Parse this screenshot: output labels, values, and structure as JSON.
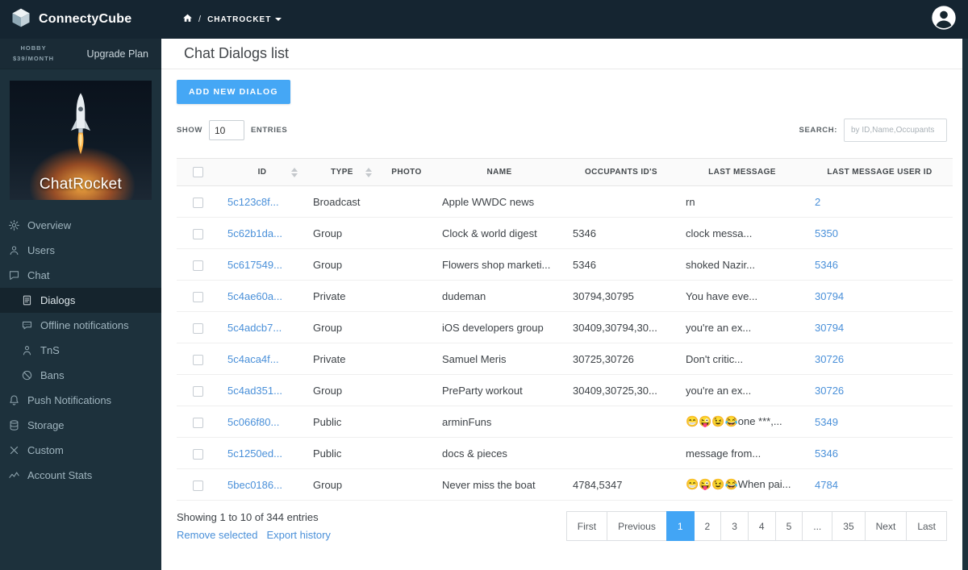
{
  "app": {
    "brand": "ConnectyCube"
  },
  "topbar": {
    "breadcrumb_app": "CHATROCKET"
  },
  "plan": {
    "tier": "HOBBY",
    "price": "$39/MONTH",
    "upgrade_label": "Upgrade Plan"
  },
  "project": {
    "name": "ChatRocket"
  },
  "sidebar": {
    "items": [
      {
        "label": "Overview"
      },
      {
        "label": "Users"
      },
      {
        "label": "Chat"
      },
      {
        "label": "Dialogs"
      },
      {
        "label": "Offline notifications"
      },
      {
        "label": "TnS"
      },
      {
        "label": "Bans"
      },
      {
        "label": "Push Notifications"
      },
      {
        "label": "Storage"
      },
      {
        "label": "Custom"
      },
      {
        "label": "Account Stats"
      }
    ]
  },
  "page": {
    "title": "Chat Dialogs list",
    "add_button": "ADD NEW DIALOG",
    "show_label": "SHOW",
    "show_value": "10",
    "entries_label": "ENTRIES",
    "search_label": "SEARCH:",
    "search_placeholder": "by ID,Name,Occupants"
  },
  "table": {
    "headers": {
      "id": "ID",
      "type": "TYPE",
      "photo": "PHOTO",
      "name": "NAME",
      "occupants": "OCCUPANTS ID'S",
      "last_message": "LAST MESSAGE",
      "last_user": "LAST MESSAGE USER ID"
    },
    "rows": [
      {
        "id": "5c123c8f...",
        "type": "Broadcast",
        "photo": "",
        "name": "Apple WWDC news",
        "occupants": "",
        "last_message": "rn",
        "last_user": "2"
      },
      {
        "id": "5c62b1da...",
        "type": "Group",
        "photo": "",
        "name": "Clock & world digest",
        "occupants": "5346",
        "last_message": "clock messa...",
        "last_user": "5350"
      },
      {
        "id": "5c617549...",
        "type": "Group",
        "photo": "",
        "name": "Flowers shop marketi...",
        "occupants": "5346",
        "last_message": "shoked Nazir...",
        "last_user": "5346"
      },
      {
        "id": "5c4ae60a...",
        "type": "Private",
        "photo": "",
        "name": "dudeman",
        "occupants": "30794,30795",
        "last_message": "You have eve...",
        "last_user": "30794"
      },
      {
        "id": "5c4adcb7...",
        "type": "Group",
        "photo": "",
        "name": "iOS developers group",
        "occupants": "30409,30794,30...",
        "last_message": "you're an ex...",
        "last_user": "30794"
      },
      {
        "id": "5c4aca4f...",
        "type": "Private",
        "photo": "",
        "name": "Samuel Meris",
        "occupants": "30725,30726",
        "last_message": "Don't critic...",
        "last_user": "30726"
      },
      {
        "id": "5c4ad351...",
        "type": "Group",
        "photo": "",
        "name": "PreParty workout",
        "occupants": "30409,30725,30...",
        "last_message": "you're an ex...",
        "last_user": "30726"
      },
      {
        "id": "5c066f80...",
        "type": "Public",
        "photo": "",
        "name": "arminFuns",
        "occupants": "",
        "last_message": "😁😜😉😂one ***,...",
        "last_user": "5349"
      },
      {
        "id": "5c1250ed...",
        "type": "Public",
        "photo": "",
        "name": "docs & pieces",
        "occupants": "",
        "last_message": "message from...",
        "last_user": "5346"
      },
      {
        "id": "5bec0186...",
        "type": "Group",
        "photo": "",
        "name": "Never miss the boat",
        "occupants": "4784,5347",
        "last_message": "😁😜😉😂When pai...",
        "last_user": "4784"
      }
    ]
  },
  "footer": {
    "showing": "Showing 1 to 10 of 344 entries",
    "remove_label": "Remove selected",
    "export_label": "Export history",
    "pagination": [
      "First",
      "Previous",
      "1",
      "2",
      "3",
      "4",
      "5",
      "...",
      "35",
      "Next",
      "Last"
    ],
    "active_index": 2
  },
  "colors": {
    "accent_blue": "#45a7f5",
    "link_blue": "#4a90d9",
    "pagination_active": "#42a5f5",
    "sidebar_dark": "#1d313c",
    "topbar_dark": "#152531"
  }
}
